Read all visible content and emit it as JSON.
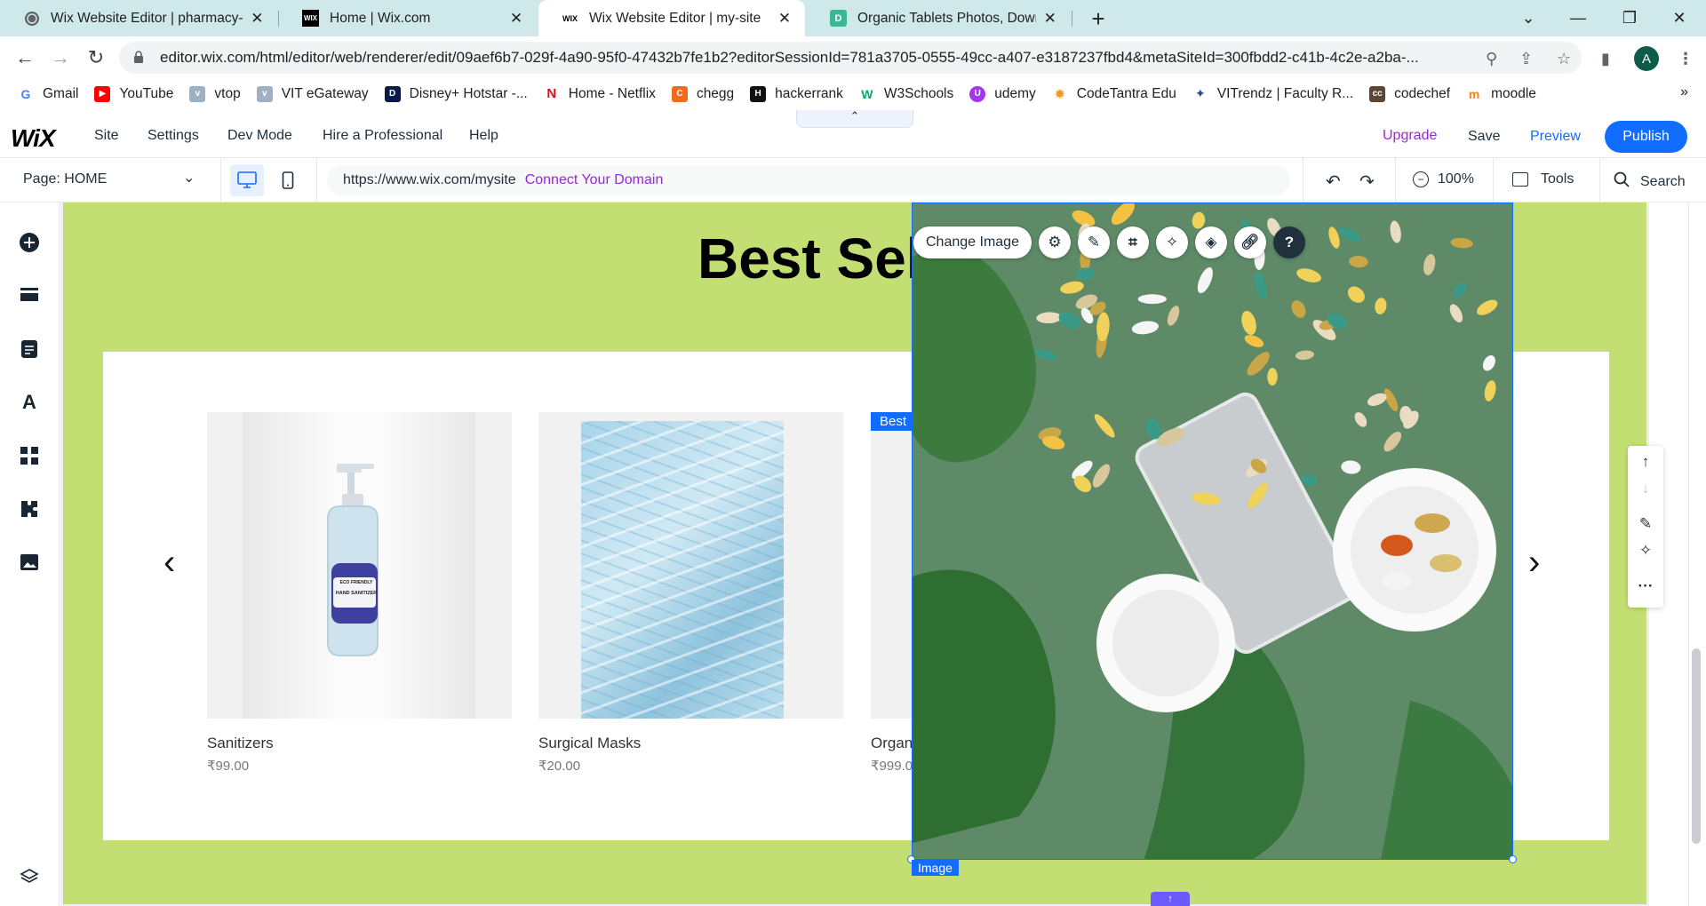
{
  "browser": {
    "tabs": [
      {
        "title": "Wix Website Editor | pharmacy-a",
        "active": false
      },
      {
        "title": "Home | Wix.com",
        "active": false
      },
      {
        "title": "Wix Website Editor | my-site",
        "active": true
      },
      {
        "title": "Organic Tablets Photos, Downlo",
        "active": false
      }
    ],
    "url": "editor.wix.com/html/editor/web/renderer/edit/09aef6b7-029f-4a90-95f0-47432b7fe1b2?editorSessionId=781a3705-0555-49cc-a407-e3187237fbd4&metaSiteId=300fbdd2-c41b-4c2e-a2ba-...",
    "profile_initial": "A",
    "bookmarks": [
      "Gmail",
      "YouTube",
      "vtop",
      "VIT eGateway",
      "Disney+ Hotstar -...",
      "Home - Netflix",
      "chegg",
      "hackerrank",
      "W3Schools",
      "udemy",
      "CodeTantra Edu",
      "VITrendz | Faculty R...",
      "codechef",
      "moodle"
    ],
    "bookmarks_more": "»"
  },
  "wix": {
    "logo": "WiX",
    "menu": [
      "Site",
      "Settings",
      "Dev Mode",
      "Hire a Professional",
      "Help"
    ],
    "upgrade": "Upgrade",
    "save": "Save",
    "preview": "Preview",
    "publish": "Publish",
    "page_selector": "Page: HOME",
    "site_url": "https://www.wix.com/mysite",
    "connect_domain": "Connect Your Domain",
    "zoom": "100%",
    "tools": "Tools",
    "search": "Search"
  },
  "canvas": {
    "heading": "Best Sel",
    "badge": "Best",
    "products": [
      {
        "name": "Sanitizers",
        "price": "₹99.00"
      },
      {
        "name": "Surgical Masks",
        "price": "₹20.00"
      },
      {
        "name": "Organ",
        "price": "₹999.0"
      }
    ],
    "sanitizer_label": "HAND SANITIZER",
    "sanitizer_brand": "ECO FRIENDLY",
    "selected_label": "Image",
    "change_image": "Change Image"
  },
  "colors": {
    "wix_blue": "#116dff",
    "section_bg": "#c3df73",
    "upgrade_purple": "#9a27d5",
    "tab_strip": "#cfe8ea"
  }
}
